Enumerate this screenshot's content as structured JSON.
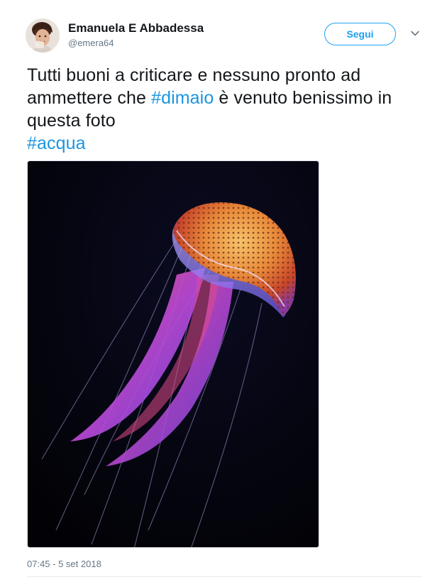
{
  "author": {
    "display_name": "Emanuela E Abbadessa",
    "handle": "@emera64"
  },
  "follow_label": "Segui",
  "tweet": {
    "text_before": "Tutti buoni a criticare e nessuno pronto ad ammettere che ",
    "hashtag_1": "#dimaio",
    "text_after": " è venuto benissimo in questa foto",
    "hashtag_2": "#acqua"
  },
  "timestamp": "07:45 - 5 set 2018",
  "colors": {
    "link_blue": "#1b95e0",
    "follow_blue": "#1da1f2",
    "secondary_text": "#657786"
  },
  "icons": {
    "caret": "chevron-down-icon"
  }
}
